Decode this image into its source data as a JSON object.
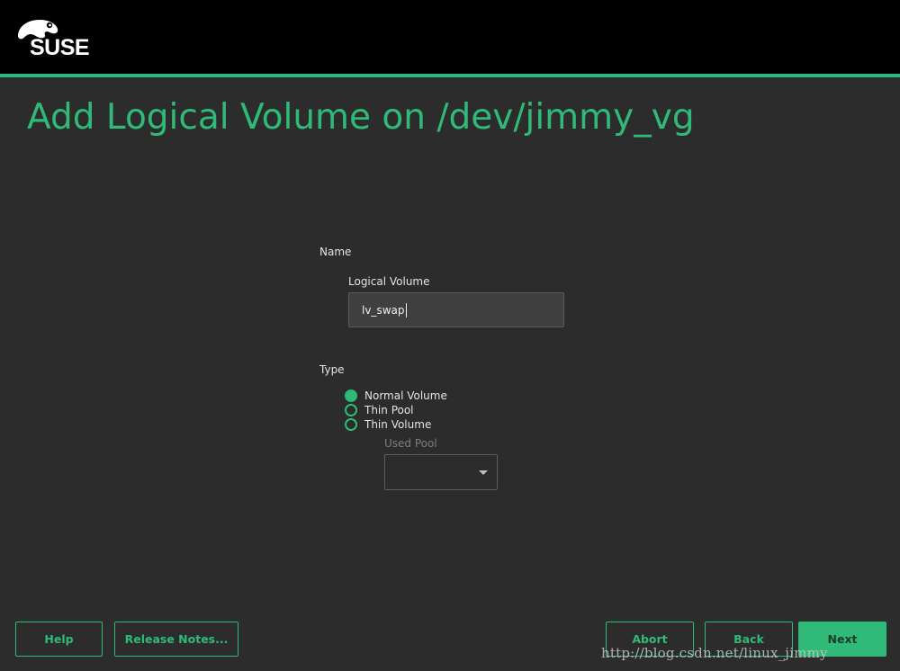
{
  "brand": {
    "logo_text": "SUSE",
    "accent_color": "#30ba78"
  },
  "page": {
    "title": "Add Logical Volume on /dev/jimmy_vg"
  },
  "name_section": {
    "label": "Name",
    "logical_volume_label": "Logical Volume",
    "logical_volume_value": "lv_swap"
  },
  "type_section": {
    "label": "Type",
    "options": [
      {
        "label": "Normal Volume",
        "checked": true
      },
      {
        "label": "Thin Pool",
        "checked": false
      },
      {
        "label": "Thin Volume",
        "checked": false
      }
    ],
    "used_pool_label": "Used Pool",
    "used_pool_value": ""
  },
  "buttons": {
    "help": "Help",
    "release_notes": "Release Notes...",
    "abort": "Abort",
    "back": "Back",
    "next": "Next"
  },
  "watermark": "http://blog.csdn.net/linux_jimmy"
}
